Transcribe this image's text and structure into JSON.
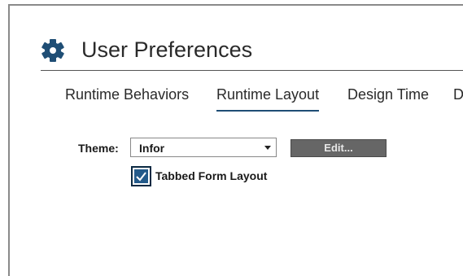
{
  "header": {
    "title": "User Preferences",
    "icon": "gear-icon",
    "icon_color": "#1f4e75"
  },
  "tabs": [
    {
      "label": "Runtime Behaviors",
      "active": false
    },
    {
      "label": "Runtime Layout",
      "active": true
    },
    {
      "label": "Design Time",
      "active": false
    },
    {
      "label": "D",
      "active": false
    }
  ],
  "form": {
    "theme_label": "Theme:",
    "theme_value": "Infor",
    "edit_label": "Edit...",
    "tabbed_form_layout_label": "Tabbed Form Layout",
    "tabbed_form_layout_checked": true
  },
  "colors": {
    "accent": "#1f4e75",
    "checkbox_fill": "#235a8a",
    "button_bg": "#666666"
  }
}
